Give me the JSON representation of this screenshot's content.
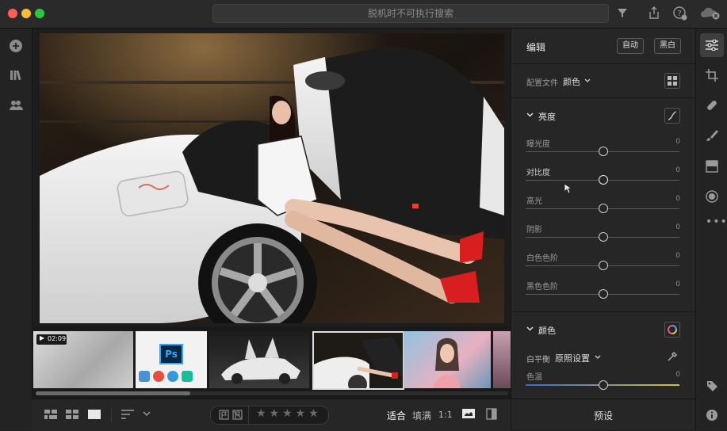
{
  "window": {
    "search_placeholder": "脱机时不可执行搜索",
    "traffic_colors": [
      "#ff5f57",
      "#febc2e",
      "#28c840"
    ]
  },
  "left_rail": {
    "items": [
      "add-icon",
      "library-icon",
      "people-icon"
    ]
  },
  "filmstrip": {
    "video_duration": "02:09",
    "thumbnails": [
      "video-thumb",
      "ps-thumb",
      "car-thumb",
      "selected-thumb",
      "portrait-thumb",
      "partial-thumb"
    ]
  },
  "bottom_bar": {
    "fit": "适合",
    "fill": "填满",
    "ratio": "1:1",
    "stars": "★★★★★"
  },
  "panel": {
    "title": "编辑",
    "auto_label": "自动",
    "bw_label": "黑白",
    "profile_label": "配置文件",
    "profile_value": "颜色",
    "light_title": "亮度",
    "sliders": [
      {
        "label": "曝光度",
        "value": "0"
      },
      {
        "label": "对比度",
        "value": "0"
      },
      {
        "label": "高光",
        "value": "0"
      },
      {
        "label": "阴影",
        "value": "0"
      },
      {
        "label": "白色色阶",
        "value": "0"
      },
      {
        "label": "黑色色阶",
        "value": "0"
      }
    ],
    "color_title": "颜色",
    "wb_label": "白平衡",
    "wb_value": "原照设置",
    "temp_label": "色温",
    "temp_value": "0",
    "presets_label": "预设"
  },
  "right_rail": {
    "items": [
      "sliders-icon",
      "crop-icon",
      "healing-icon",
      "brush-icon",
      "gradient-icon",
      "radial-icon",
      "more-icon",
      "tag-icon",
      "info-icon"
    ]
  }
}
